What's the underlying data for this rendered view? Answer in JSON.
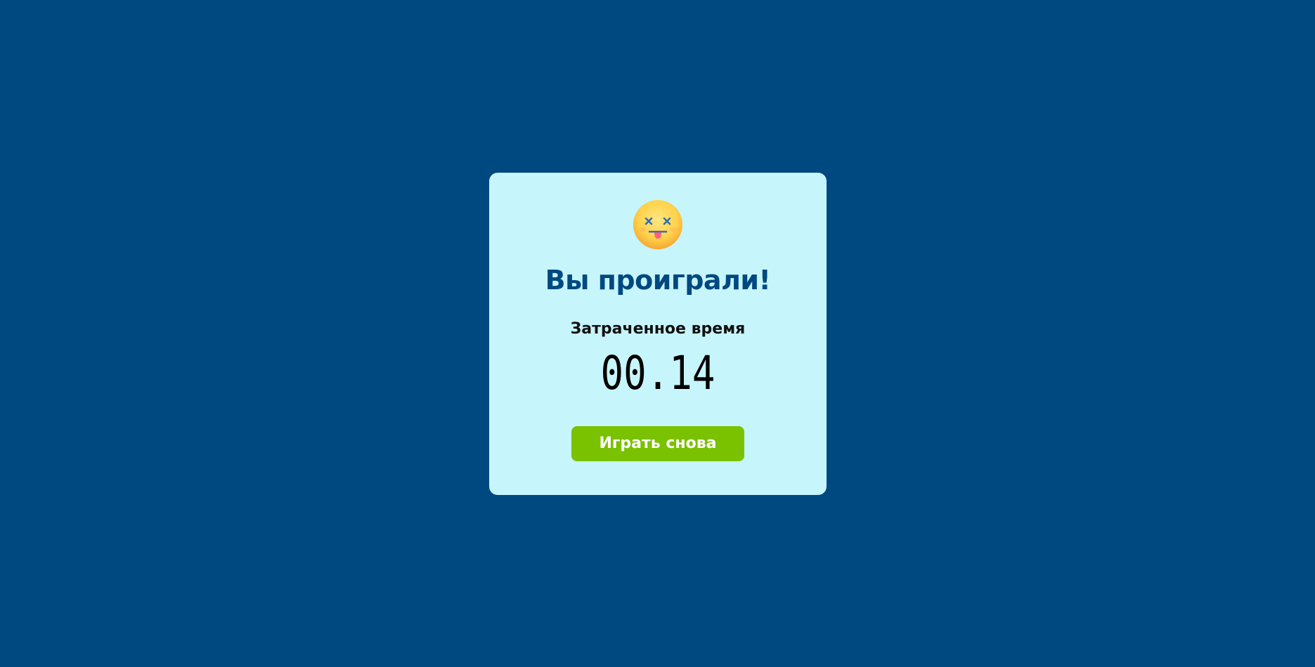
{
  "colors": {
    "background": "#004980",
    "modal_background": "#c7f5fc",
    "title": "#004980",
    "button": "#7ac100",
    "button_text": "#ffffff"
  },
  "result": {
    "icon": "dizzy-face-icon",
    "title": "Вы проиграли!",
    "time_label": "Затраченное время",
    "time_value": "00.14"
  },
  "actions": {
    "play_again_label": "Играть снова"
  }
}
